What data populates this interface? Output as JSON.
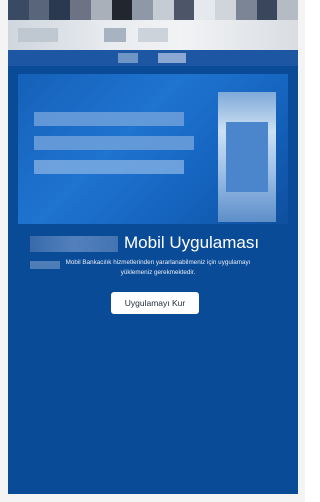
{
  "app": {
    "title": "Mobil Uygulaması",
    "message_line1": "Mobil Bankacılık hizmetlerinden yararlanabilmeniz için uygulamayı",
    "message_line2": "yüklemeniz gerekmektedir.",
    "install_button_label": "Uygulamayı Kur"
  },
  "colors": {
    "background": "#0a4b98",
    "button_background": "#ffffff",
    "text": "#ffffff"
  }
}
